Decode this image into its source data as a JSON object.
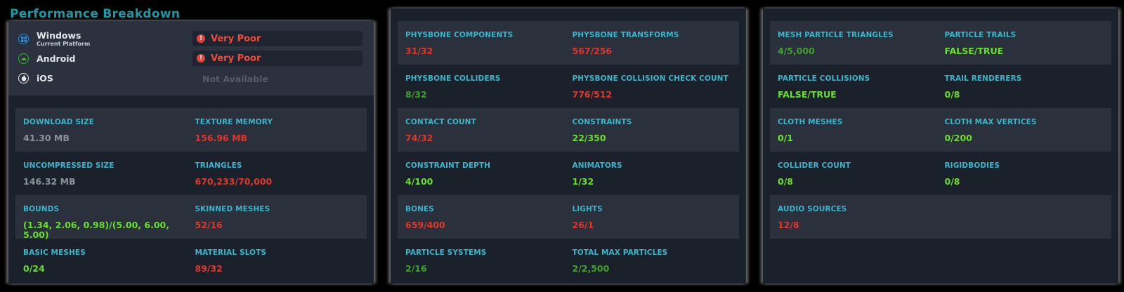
{
  "title": "Performance Breakdown",
  "colors": {
    "red": "#e3362a",
    "green": "#6adf2c",
    "dark_green": "#40a02c",
    "gray": "#8b929d",
    "label": "#3bb4cc"
  },
  "platforms": [
    {
      "name": "Windows",
      "sub": "Current Platform",
      "icon": "windows-icon",
      "rating": "Very Poor",
      "available": true
    },
    {
      "name": "Android",
      "sub": "",
      "icon": "android-icon",
      "rating": "Very Poor",
      "available": true
    },
    {
      "name": "iOS",
      "sub": "",
      "icon": "apple-icon",
      "rating": "Not Available",
      "available": false
    }
  ],
  "panel1": [
    [
      {
        "label": "DOWNLOAD SIZE",
        "value": "41.30 MB",
        "color": "gray"
      },
      {
        "label": "TEXTURE MEMORY",
        "value": "156.96 MB",
        "color": "red"
      }
    ],
    [
      {
        "label": "UNCOMPRESSED SIZE",
        "value": "146.32 MB",
        "color": "gray"
      },
      {
        "label": "TRIANGLES",
        "value": "670,233/70,000",
        "color": "red"
      }
    ],
    [
      {
        "label": "BOUNDS",
        "value": "(1.34, 2.06, 0.98)/(5.00, 6.00, 5.00)",
        "color": "green"
      },
      {
        "label": "SKINNED MESHES",
        "value": "52/16",
        "color": "red"
      }
    ],
    [
      {
        "label": "BASIC MESHES",
        "value": "0/24",
        "color": "green"
      },
      {
        "label": "MATERIAL SLOTS",
        "value": "89/32",
        "color": "red"
      }
    ]
  ],
  "panel2": [
    [
      {
        "label": "PHYSBONE COMPONENTS",
        "value": "31/32",
        "color": "red"
      },
      {
        "label": "PHYSBONE TRANSFORMS",
        "value": "567/256",
        "color": "red"
      }
    ],
    [
      {
        "label": "PHYSBONE COLLIDERS",
        "value": "8/32",
        "color": "dark_green"
      },
      {
        "label": "PHYSBONE COLLISION CHECK COUNT",
        "value": "776/512",
        "color": "red"
      }
    ],
    [
      {
        "label": "CONTACT COUNT",
        "value": "74/32",
        "color": "red"
      },
      {
        "label": "CONSTRAINTS",
        "value": "22/350",
        "color": "green"
      }
    ],
    [
      {
        "label": "CONSTRAINT DEPTH",
        "value": "4/100",
        "color": "green"
      },
      {
        "label": "ANIMATORS",
        "value": "1/32",
        "color": "green"
      }
    ],
    [
      {
        "label": "BONES",
        "value": "659/400",
        "color": "red"
      },
      {
        "label": "LIGHTS",
        "value": "26/1",
        "color": "red"
      }
    ],
    [
      {
        "label": "PARTICLE SYSTEMS",
        "value": "2/16",
        "color": "dark_green"
      },
      {
        "label": "TOTAL MAX PARTICLES",
        "value": "2/2,500",
        "color": "dark_green"
      }
    ]
  ],
  "panel3": [
    [
      {
        "label": "MESH PARTICLE TRIANGLES",
        "value": "4/5,000",
        "color": "dark_green"
      },
      {
        "label": "PARTICLE TRAILS",
        "value": "FALSE/TRUE",
        "color": "green"
      }
    ],
    [
      {
        "label": "PARTICLE COLLISIONS",
        "value": "FALSE/TRUE",
        "color": "green"
      },
      {
        "label": "TRAIL RENDERERS",
        "value": "0/8",
        "color": "green"
      }
    ],
    [
      {
        "label": "CLOTH MESHES",
        "value": "0/1",
        "color": "green"
      },
      {
        "label": "CLOTH MAX VERTICES",
        "value": "0/200",
        "color": "green"
      }
    ],
    [
      {
        "label": "COLLIDER COUNT",
        "value": "0/8",
        "color": "green"
      },
      {
        "label": "RIGIDBODIES",
        "value": "0/8",
        "color": "green"
      }
    ],
    [
      {
        "label": "AUDIO SOURCES",
        "value": "12/8",
        "color": "red"
      },
      {
        "label": "",
        "value": "",
        "color": "green"
      }
    ]
  ]
}
